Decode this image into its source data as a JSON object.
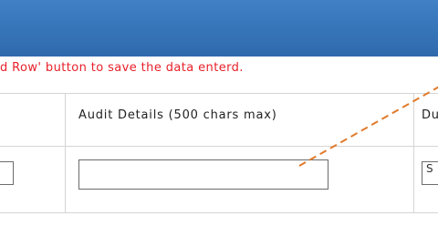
{
  "instruction": {
    "text": "d Row' button to save the data enterd.",
    "color": "#e8202a"
  },
  "table": {
    "columns": [
      {
        "label": ""
      },
      {
        "label": "Audit Details (500 chars max)"
      },
      {
        "label": "Du"
      }
    ],
    "row": {
      "left_select_text": "",
      "audit_details_value": "",
      "right_select_text": "S"
    }
  },
  "annotation": {
    "arrow_color": "#e07b2c"
  }
}
